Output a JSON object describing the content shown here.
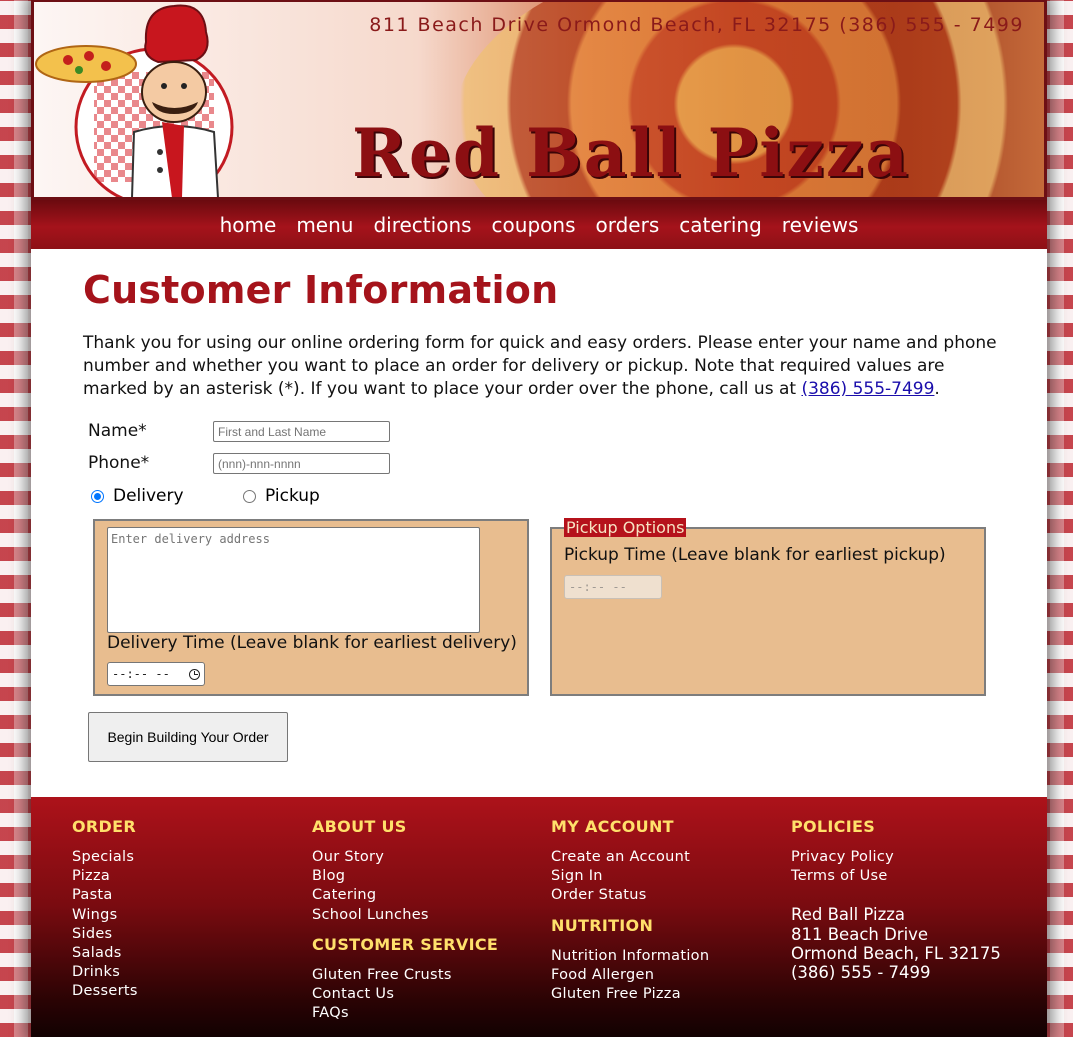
{
  "header": {
    "address_line": "811 Beach Drive  Ormond Beach, FL  32175   (386) 555 - 7499",
    "brand": "Red Ball Pizza"
  },
  "nav": [
    {
      "label": "home"
    },
    {
      "label": "menu"
    },
    {
      "label": "directions"
    },
    {
      "label": "coupons"
    },
    {
      "label": "orders"
    },
    {
      "label": "catering"
    },
    {
      "label": "reviews"
    }
  ],
  "main": {
    "title": "Customer Information",
    "intro_text": "Thank you for using our online ordering form for quick and easy orders. Please enter your name and phone number and whether you want to place an order for delivery or pickup. Note that required values are marked by an asterisk (*). If you want to place your order over the phone, call us at ",
    "intro_phone_link": "(386) 555-7499",
    "intro_end": "."
  },
  "form": {
    "name_label": "Name*",
    "name_placeholder": "First and Last Name",
    "phone_label": "Phone*",
    "phone_placeholder": "(nnn)-nnn-nnnn",
    "delivery_label": "Delivery",
    "pickup_label": "Pickup",
    "selected": "delivery",
    "address_placeholder": "Enter delivery address",
    "delivery_time_label": "Delivery Time (Leave blank for earliest delivery)",
    "delivery_time_value": "--:-- --",
    "pickup_legend": "Pickup Options",
    "pickup_time_label": "Pickup Time (Leave blank for earliest pickup)",
    "pickup_time_value": "--:-- --",
    "submit_label": "Begin Building Your Order"
  },
  "footer": {
    "order": {
      "heading": "ORDER",
      "items": [
        "Specials",
        "Pizza",
        "Pasta",
        "Wings",
        "Sides",
        "Salads",
        "Drinks",
        "Desserts"
      ]
    },
    "about": {
      "heading": "ABOUT US",
      "items": [
        "Our Story",
        "Blog",
        "Catering",
        "School Lunches"
      ]
    },
    "service": {
      "heading": "CUSTOMER SERVICE",
      "items": [
        "Gluten Free Crusts",
        "Contact Us",
        "FAQs"
      ]
    },
    "account": {
      "heading": "MY ACCOUNT",
      "items": [
        "Create an Account",
        "Sign In",
        "Order Status"
      ]
    },
    "nutrition": {
      "heading": "NUTRITION",
      "items": [
        "Nutrition Information",
        "Food Allergen",
        "Gluten Free Pizza"
      ]
    },
    "policies": {
      "heading": "POLICIES",
      "items": [
        "Privacy Policy",
        "Terms of Use"
      ]
    },
    "address": [
      "Red Ball Pizza",
      "811 Beach Drive",
      "Ormond Beach, FL 32175",
      "(386) 555 - 7499"
    ]
  },
  "colors": {
    "brand_red": "#a5131b",
    "panel_tan": "#e8bd8f",
    "footer_heading": "#ffe06b"
  }
}
